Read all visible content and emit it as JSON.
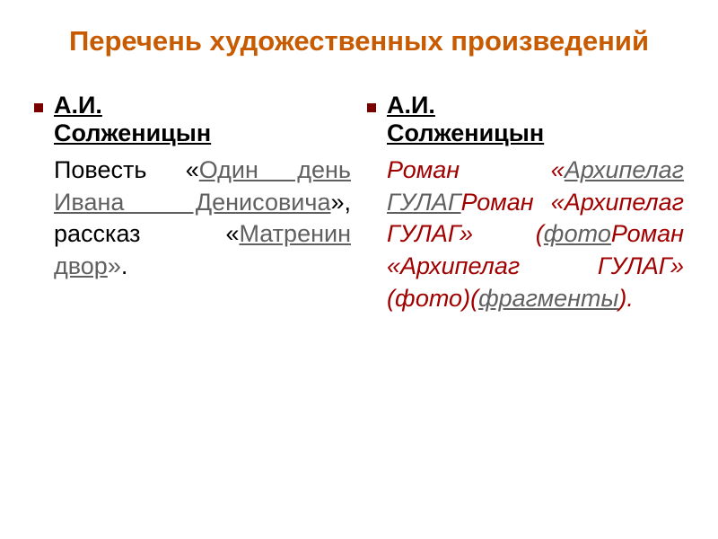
{
  "title": "Перечень художественных произведений",
  "left": {
    "author_line1": "А.И.",
    "author_line2": "Солженицын",
    "t1": "Повесть «",
    "link1": "Один день Ивана Денисовича",
    "t2": "», рассказ «",
    "link2": "Матренин двор",
    "t3": "».",
    "period": "."
  },
  "right": {
    "author_line1": "А.И.",
    "author_line2": "Солженицын",
    "r1": "Роман «",
    "link1": "Архипелаг ГУЛАГ",
    "r2": "Роман «Архипелаг ГУЛАГ» (",
    "link2": "фото",
    "r3": "Роман «Архипелаг ГУЛАГ» (фото)(",
    "link3": "фрагменты",
    "r4": ").",
    "roman_label": "Роман"
  }
}
